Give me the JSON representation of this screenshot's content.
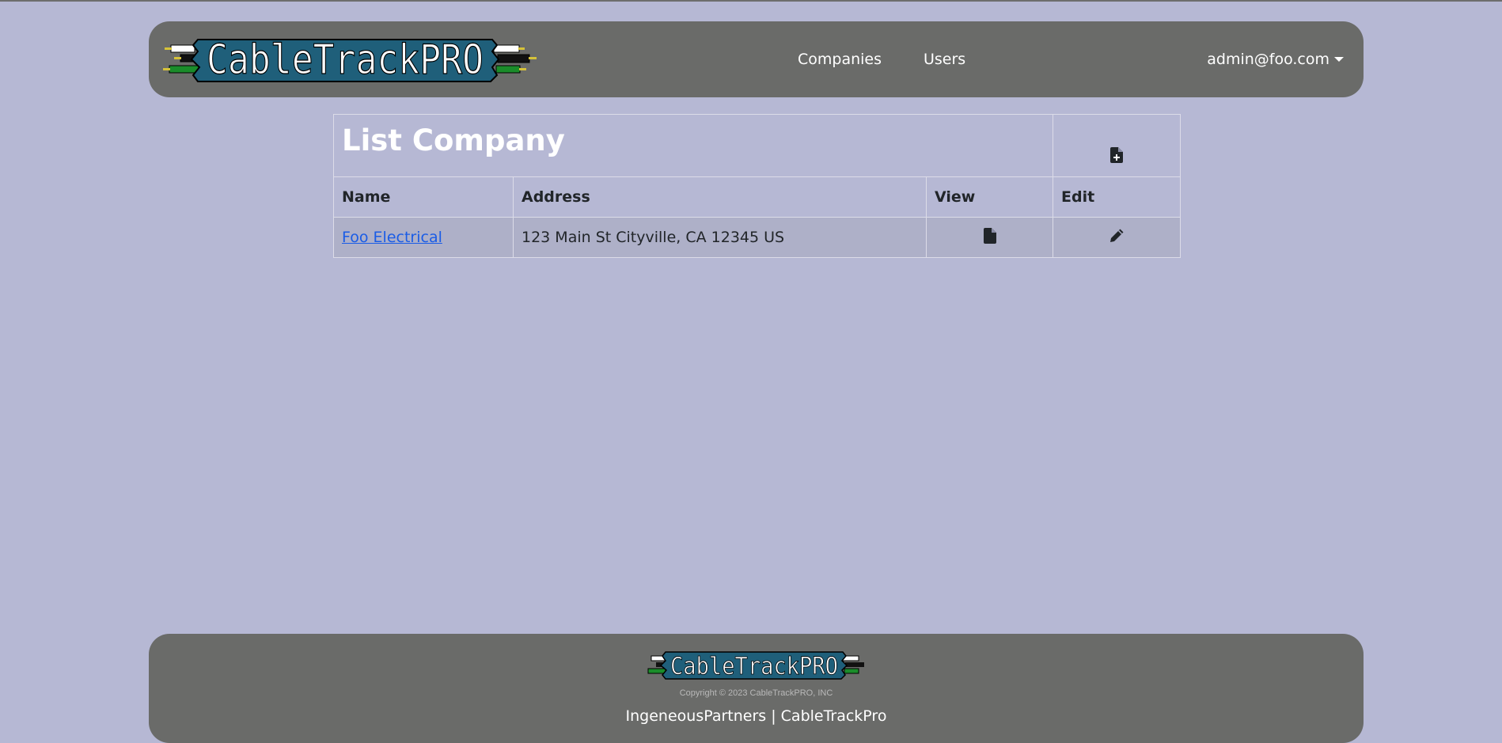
{
  "brand": {
    "logo_text": "CableTrackPRO"
  },
  "nav": {
    "companies": "Companies",
    "users": "Users",
    "user_email": "admin@foo.com"
  },
  "page": {
    "title": "List Company"
  },
  "table": {
    "headers": {
      "name": "Name",
      "address": "Address",
      "view": "View",
      "edit": "Edit"
    },
    "rows": [
      {
        "name": "Foo Electrical",
        "address": "123 Main St Cityville, CA 12345 US"
      }
    ]
  },
  "icons": {
    "new": "file-plus-icon",
    "view": "file-icon",
    "edit": "pencil-icon"
  },
  "footer": {
    "copyright": "Copyright © 2023 CableTrackPRO, INC",
    "links": "IngeneousPartners | CableTrackPro"
  },
  "colors": {
    "background": "#b6b8d4",
    "panel": "#6a6b69",
    "logo_banner": "#1f5f7a",
    "link": "#1a5ce6"
  }
}
